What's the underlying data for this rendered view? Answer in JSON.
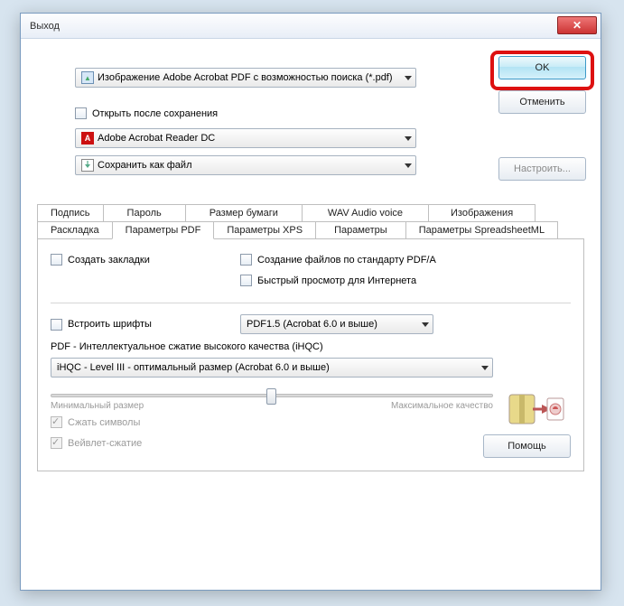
{
  "window": {
    "title": "Выход"
  },
  "buttons": {
    "ok": "OK",
    "cancel": "Отменить",
    "configure": "Настроить...",
    "help": "Помощь"
  },
  "top": {
    "format_combo": "Изображение Adobe Acrobat PDF с возможностью поиска (*.pdf)",
    "open_after_save": "Открыть после сохранения",
    "reader_combo": "Adobe Acrobat Reader DC",
    "save_combo": "Сохранить как файл"
  },
  "tabs": {
    "row1": [
      "Подпись",
      "Пароль",
      "Размер бумаги",
      "WAV Audio voice",
      "Изображения"
    ],
    "row2": [
      "Раскладка",
      "Параметры PDF",
      "Параметры XPS",
      "Параметры",
      "Параметры SpreadsheetML"
    ],
    "active": "Параметры PDF"
  },
  "pdf_panel": {
    "create_bookmarks": "Создать закладки",
    "pdf_a": "Создание файлов по стандарту PDF/A",
    "fast_web": "Быстрый просмотр для Интернета",
    "embed_fonts": "Встроить шрифты",
    "pdf_version_combo": "PDF1.5 (Acrobat 6.0 и выше)",
    "ihqc_label": "PDF - Интеллектуальное сжатие высокого качества (iHQC)",
    "ihqc_combo": "iHQC - Level III - оптимальный размер (Acrobat 6.0 и выше)",
    "slider_min": "Минимальный размер",
    "slider_max": "Максимальное качество",
    "compress_symbols": "Сжать символы",
    "wavelet": "Вейвлет-сжатие"
  }
}
